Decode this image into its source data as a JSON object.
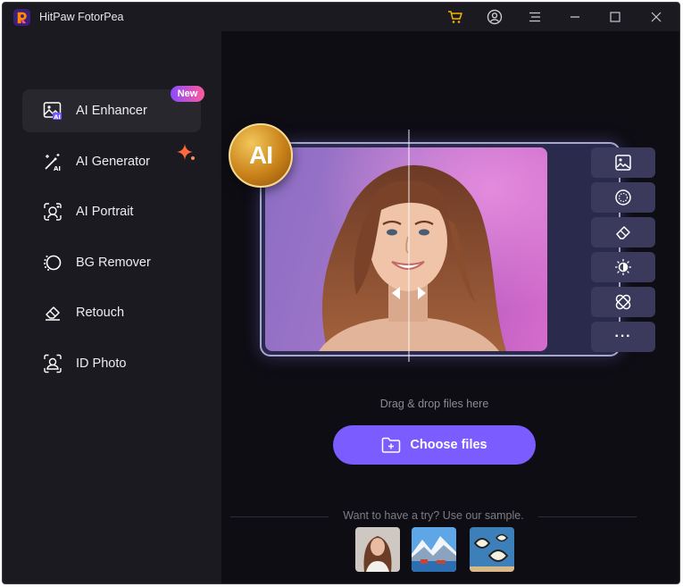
{
  "app": {
    "title": "HitPaw FotorPea"
  },
  "titlebar": {
    "icons": [
      "cart-icon",
      "account-icon",
      "menu-icon",
      "minimize-icon",
      "maximize-icon",
      "close-icon"
    ],
    "accent_cart": "#f5b400"
  },
  "sidebar": {
    "items": [
      {
        "label": "AI Enhancer",
        "icon": "ai-enhancer-icon",
        "active": true,
        "badge": "New"
      },
      {
        "label": "AI Generator",
        "icon": "ai-generator-icon"
      },
      {
        "label": "AI Portrait",
        "icon": "ai-portrait-icon"
      },
      {
        "label": "BG Remover",
        "icon": "bg-remover-icon"
      },
      {
        "label": "Retouch",
        "icon": "retouch-icon"
      },
      {
        "label": "ID Photo",
        "icon": "id-photo-icon"
      }
    ]
  },
  "preview": {
    "badge": "AI",
    "tools": [
      "image-icon",
      "pattern-icon",
      "eraser-icon",
      "brightness-icon",
      "heal-icon",
      "more-icon"
    ],
    "more_label": "···"
  },
  "upload": {
    "drag_text": "Drag & drop files here",
    "choose_label": "Choose files",
    "accent": "#7a5cff"
  },
  "samples": {
    "text": "Want to have a try? Use our sample.",
    "items": [
      "sample-portrait",
      "sample-landscape",
      "sample-fish"
    ]
  }
}
